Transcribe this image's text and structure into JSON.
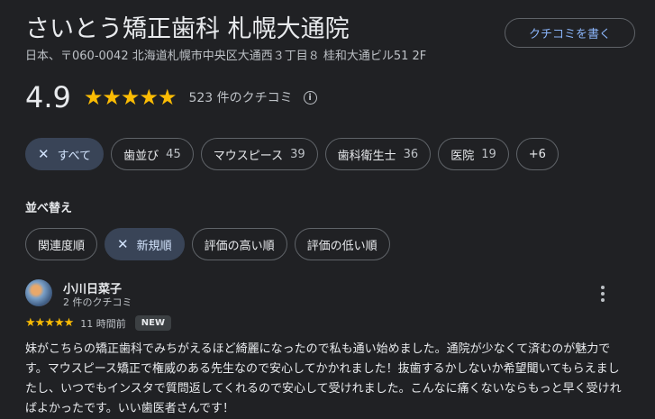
{
  "place": {
    "title": "さいとう矯正歯科 札幌大通院",
    "address": "日本、〒060-0042 北海道札幌市中央区大通西３丁目８ 桂和大通ビル51 2F",
    "write_review_label": "クチコミを書く"
  },
  "rating": {
    "value": "4.9",
    "stars": 5,
    "count_label": "523 件のクチコミ",
    "info_icon": "i"
  },
  "filters": [
    {
      "label": "すべて",
      "count": "",
      "selected": true
    },
    {
      "label": "歯並び",
      "count": "45",
      "selected": false
    },
    {
      "label": "マウスピース",
      "count": "39",
      "selected": false
    },
    {
      "label": "歯科衛生士",
      "count": "36",
      "selected": false
    },
    {
      "label": "医院",
      "count": "19",
      "selected": false
    },
    {
      "label": "+6",
      "count": "",
      "selected": false
    }
  ],
  "sort": {
    "label": "並べ替え",
    "options": [
      {
        "label": "関連度順",
        "selected": false
      },
      {
        "label": "新規順",
        "selected": true
      },
      {
        "label": "評価の高い順",
        "selected": false
      },
      {
        "label": "評価の低い順",
        "selected": false
      }
    ]
  },
  "review": {
    "author": "小川日菜子",
    "author_sub": "2 件のクチコミ",
    "stars": 5,
    "time": "11 時間前",
    "badge": "NEW",
    "text": "妹がこちらの矯正歯科でみちがえるほど綺麗になったので私も通い始めました。通院が少なくて済むのが魅力です。マウスピース矯正で権威のある先生なので安心してかかれました！抜歯するかしないか希望聞いてもらえましたし、いつでもインスタで質問返してくれるので安心して受けれました。こんなに痛くないならもっと早く受ければよかったです。いい歯医者さんです！"
  },
  "colors": {
    "background": "#202124",
    "star": "#fbbc04",
    "link": "#8ab4f8",
    "selected_chip": "#394457"
  }
}
